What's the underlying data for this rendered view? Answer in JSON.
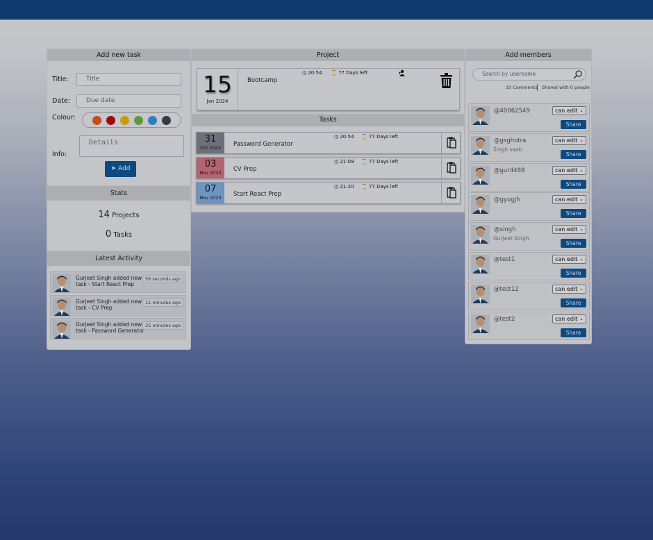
{
  "left": {
    "header": "Add new task",
    "title_label": "Title:",
    "title_placeholder": "Title",
    "date_label": "Date:",
    "date_placeholder": "Due date",
    "colour_label": "Colour:",
    "colours": [
      "#c44d1f",
      "#9e0b0b",
      "#c89b08",
      "#5f9a39",
      "#2f7dc5",
      "#353a45"
    ],
    "info_label": "Info:",
    "details_placeholder": "Details",
    "add_label": "Add",
    "stats_header": "Stats",
    "projects_count": "14",
    "projects_label": "Projects",
    "tasks_count": "0",
    "tasks_label": "Tasks",
    "activity_header": "Latest Activity",
    "activity": [
      {
        "msg": "Gurjeet Singh added new task - Start React Prep",
        "ago": "56 seconds ago"
      },
      {
        "msg": "Gurjeet Singh added new task - CV Prep",
        "ago": "11 minutes ago"
      },
      {
        "msg": "Gurjeet Singh added new task - Password Generator",
        "ago": "25 minutes ago"
      }
    ]
  },
  "project": {
    "header": "Project",
    "day": "15",
    "month_year": "Jan 2024",
    "name": "Bootcamp",
    "time": "20:54",
    "days_left": "77 Days left",
    "tasks_header": "Tasks",
    "tasks": [
      {
        "day": "31",
        "month_year": "Oct 2023",
        "name": "Password Generator",
        "time": "20:54",
        "days_left": "77 Days left",
        "color": "#6d7079"
      },
      {
        "day": "03",
        "month_year": "Nov 2023",
        "name": "CV Prep",
        "time": "21:09",
        "days_left": "77 Days left",
        "color": "#b46470"
      },
      {
        "day": "07",
        "month_year": "Nov 2023",
        "name": "Start React Prep",
        "time": "21:20",
        "days_left": "77 Days left",
        "color": "#6e94c0"
      }
    ]
  },
  "members": {
    "header": "Add members",
    "search_placeholder": "Search by username",
    "comments": "10 Comments",
    "shared": "Shared with 0 people",
    "permission": "can edit",
    "share_label": "Share",
    "list": [
      {
        "username": "@40062549",
        "full": ""
      },
      {
        "username": "@gsghotra",
        "full": "Singh saab"
      },
      {
        "username": "@gur4488",
        "full": ""
      },
      {
        "username": "@gyugjh",
        "full": ""
      },
      {
        "username": "@singh",
        "full": "Gurjeet Singh"
      },
      {
        "username": "@test1",
        "full": ""
      },
      {
        "username": "@test12",
        "full": ""
      },
      {
        "username": "@test2",
        "full": ""
      }
    ]
  }
}
